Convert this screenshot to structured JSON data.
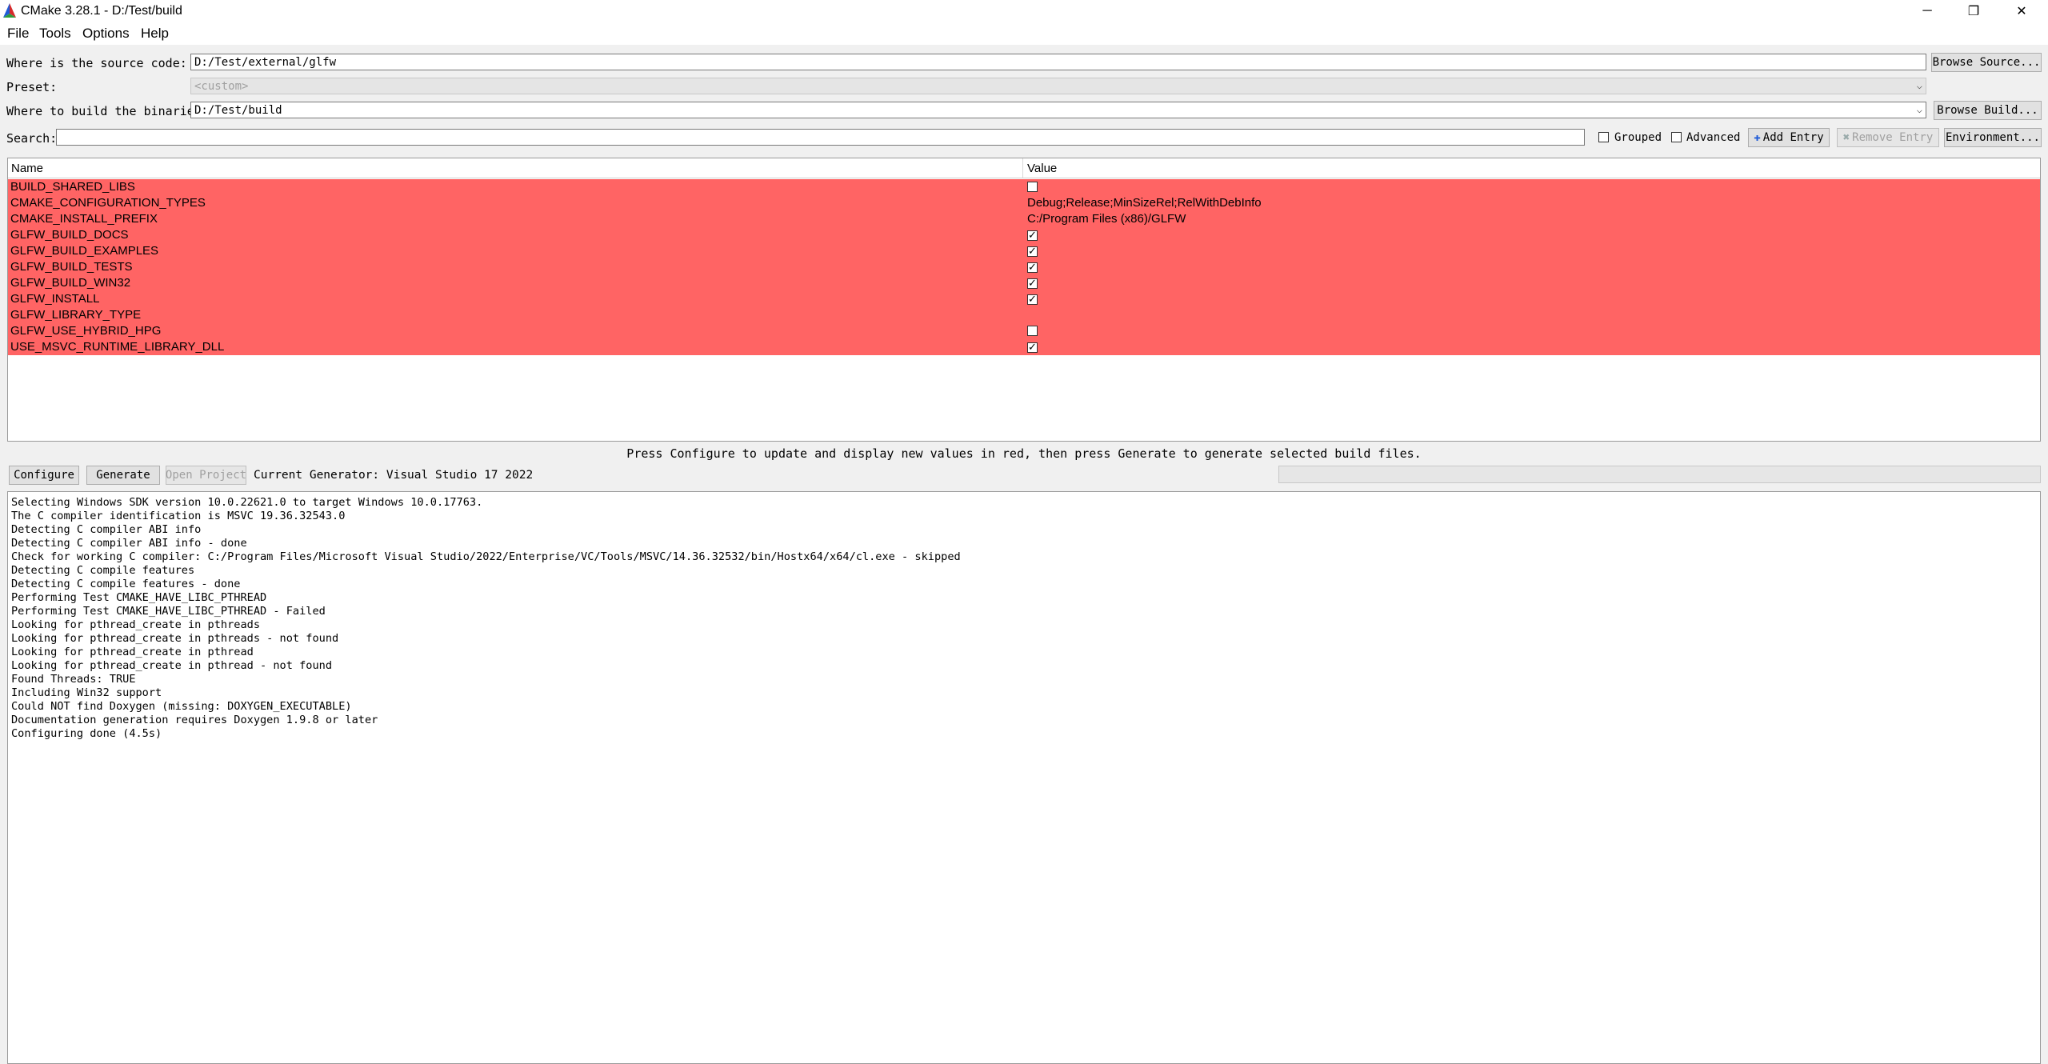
{
  "window": {
    "title": "CMake 3.28.1 - D:/Test/build",
    "minimize": "─",
    "restore": "❐",
    "close": "✕"
  },
  "menu": [
    "File",
    "Tools",
    "Options",
    "Help"
  ],
  "source": {
    "label": "Where is the source code:",
    "value": "D:/Test/external/glfw",
    "browse": "Browse Source..."
  },
  "preset": {
    "label": "Preset:",
    "value": "<custom>"
  },
  "binaries": {
    "label": "Where to build the binaries:",
    "value": "D:/Test/build",
    "browse": "Browse Build..."
  },
  "search": {
    "label": "Search:",
    "value": "",
    "grouped": "Grouped",
    "advanced": "Advanced",
    "add_entry": "Add Entry",
    "remove_entry": "Remove Entry",
    "environment": "Environment..."
  },
  "table": {
    "col_name": "Name",
    "col_value": "Value",
    "rows": [
      {
        "name": "BUILD_SHARED_LIBS",
        "type": "bool",
        "value": false
      },
      {
        "name": "CMAKE_CONFIGURATION_TYPES",
        "type": "text",
        "value": "Debug;Release;MinSizeRel;RelWithDebInfo"
      },
      {
        "name": "CMAKE_INSTALL_PREFIX",
        "type": "text",
        "value": "C:/Program Files (x86)/GLFW"
      },
      {
        "name": "GLFW_BUILD_DOCS",
        "type": "bool",
        "value": true
      },
      {
        "name": "GLFW_BUILD_EXAMPLES",
        "type": "bool",
        "value": true
      },
      {
        "name": "GLFW_BUILD_TESTS",
        "type": "bool",
        "value": true
      },
      {
        "name": "GLFW_BUILD_WIN32",
        "type": "bool",
        "value": true
      },
      {
        "name": "GLFW_INSTALL",
        "type": "bool",
        "value": true
      },
      {
        "name": "GLFW_LIBRARY_TYPE",
        "type": "text",
        "value": ""
      },
      {
        "name": "GLFW_USE_HYBRID_HPG",
        "type": "bool",
        "value": false
      },
      {
        "name": "USE_MSVC_RUNTIME_LIBRARY_DLL",
        "type": "bool",
        "value": true
      }
    ]
  },
  "hint": "Press Configure to update and display new values in red, then press Generate to generate selected build files.",
  "actions": {
    "configure": "Configure",
    "generate": "Generate",
    "open_project": "Open Project",
    "generator": "Current Generator: Visual Studio 17 2022"
  },
  "output": [
    "Selecting Windows SDK version 10.0.22621.0 to target Windows 10.0.17763.",
    "The C compiler identification is MSVC 19.36.32543.0",
    "Detecting C compiler ABI info",
    "Detecting C compiler ABI info - done",
    "Check for working C compiler: C:/Program Files/Microsoft Visual Studio/2022/Enterprise/VC/Tools/MSVC/14.36.32532/bin/Hostx64/x64/cl.exe - skipped",
    "Detecting C compile features",
    "Detecting C compile features - done",
    "Performing Test CMAKE_HAVE_LIBC_PTHREAD",
    "Performing Test CMAKE_HAVE_LIBC_PTHREAD - Failed",
    "Looking for pthread_create in pthreads",
    "Looking for pthread_create in pthreads - not found",
    "Looking for pthread_create in pthread",
    "Looking for pthread_create in pthread - not found",
    "Found Threads: TRUE",
    "Including Win32 support",
    "Could NOT find Doxygen (missing: DOXYGEN_EXECUTABLE)",
    "Documentation generation requires Doxygen 1.9.8 or later",
    "Configuring done (4.5s)"
  ],
  "colors": {
    "changed_row": "#ff6464",
    "window_bg": "#f0f0f0"
  }
}
